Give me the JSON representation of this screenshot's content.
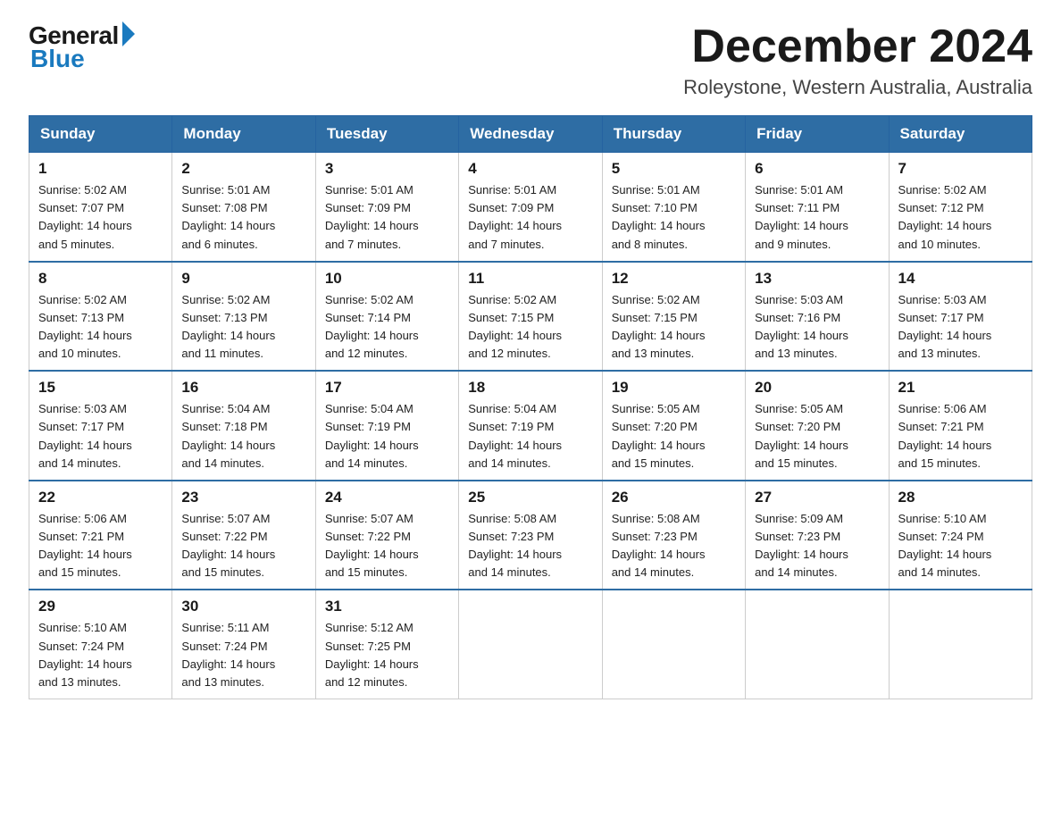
{
  "logo": {
    "general": "General",
    "blue": "Blue"
  },
  "title": "December 2024",
  "location": "Roleystone, Western Australia, Australia",
  "weekdays": [
    "Sunday",
    "Monday",
    "Tuesday",
    "Wednesday",
    "Thursday",
    "Friday",
    "Saturday"
  ],
  "weeks": [
    [
      {
        "day": "1",
        "info": "Sunrise: 5:02 AM\nSunset: 7:07 PM\nDaylight: 14 hours\nand 5 minutes."
      },
      {
        "day": "2",
        "info": "Sunrise: 5:01 AM\nSunset: 7:08 PM\nDaylight: 14 hours\nand 6 minutes."
      },
      {
        "day": "3",
        "info": "Sunrise: 5:01 AM\nSunset: 7:09 PM\nDaylight: 14 hours\nand 7 minutes."
      },
      {
        "day": "4",
        "info": "Sunrise: 5:01 AM\nSunset: 7:09 PM\nDaylight: 14 hours\nand 7 minutes."
      },
      {
        "day": "5",
        "info": "Sunrise: 5:01 AM\nSunset: 7:10 PM\nDaylight: 14 hours\nand 8 minutes."
      },
      {
        "day": "6",
        "info": "Sunrise: 5:01 AM\nSunset: 7:11 PM\nDaylight: 14 hours\nand 9 minutes."
      },
      {
        "day": "7",
        "info": "Sunrise: 5:02 AM\nSunset: 7:12 PM\nDaylight: 14 hours\nand 10 minutes."
      }
    ],
    [
      {
        "day": "8",
        "info": "Sunrise: 5:02 AM\nSunset: 7:13 PM\nDaylight: 14 hours\nand 10 minutes."
      },
      {
        "day": "9",
        "info": "Sunrise: 5:02 AM\nSunset: 7:13 PM\nDaylight: 14 hours\nand 11 minutes."
      },
      {
        "day": "10",
        "info": "Sunrise: 5:02 AM\nSunset: 7:14 PM\nDaylight: 14 hours\nand 12 minutes."
      },
      {
        "day": "11",
        "info": "Sunrise: 5:02 AM\nSunset: 7:15 PM\nDaylight: 14 hours\nand 12 minutes."
      },
      {
        "day": "12",
        "info": "Sunrise: 5:02 AM\nSunset: 7:15 PM\nDaylight: 14 hours\nand 13 minutes."
      },
      {
        "day": "13",
        "info": "Sunrise: 5:03 AM\nSunset: 7:16 PM\nDaylight: 14 hours\nand 13 minutes."
      },
      {
        "day": "14",
        "info": "Sunrise: 5:03 AM\nSunset: 7:17 PM\nDaylight: 14 hours\nand 13 minutes."
      }
    ],
    [
      {
        "day": "15",
        "info": "Sunrise: 5:03 AM\nSunset: 7:17 PM\nDaylight: 14 hours\nand 14 minutes."
      },
      {
        "day": "16",
        "info": "Sunrise: 5:04 AM\nSunset: 7:18 PM\nDaylight: 14 hours\nand 14 minutes."
      },
      {
        "day": "17",
        "info": "Sunrise: 5:04 AM\nSunset: 7:19 PM\nDaylight: 14 hours\nand 14 minutes."
      },
      {
        "day": "18",
        "info": "Sunrise: 5:04 AM\nSunset: 7:19 PM\nDaylight: 14 hours\nand 14 minutes."
      },
      {
        "day": "19",
        "info": "Sunrise: 5:05 AM\nSunset: 7:20 PM\nDaylight: 14 hours\nand 15 minutes."
      },
      {
        "day": "20",
        "info": "Sunrise: 5:05 AM\nSunset: 7:20 PM\nDaylight: 14 hours\nand 15 minutes."
      },
      {
        "day": "21",
        "info": "Sunrise: 5:06 AM\nSunset: 7:21 PM\nDaylight: 14 hours\nand 15 minutes."
      }
    ],
    [
      {
        "day": "22",
        "info": "Sunrise: 5:06 AM\nSunset: 7:21 PM\nDaylight: 14 hours\nand 15 minutes."
      },
      {
        "day": "23",
        "info": "Sunrise: 5:07 AM\nSunset: 7:22 PM\nDaylight: 14 hours\nand 15 minutes."
      },
      {
        "day": "24",
        "info": "Sunrise: 5:07 AM\nSunset: 7:22 PM\nDaylight: 14 hours\nand 15 minutes."
      },
      {
        "day": "25",
        "info": "Sunrise: 5:08 AM\nSunset: 7:23 PM\nDaylight: 14 hours\nand 14 minutes."
      },
      {
        "day": "26",
        "info": "Sunrise: 5:08 AM\nSunset: 7:23 PM\nDaylight: 14 hours\nand 14 minutes."
      },
      {
        "day": "27",
        "info": "Sunrise: 5:09 AM\nSunset: 7:23 PM\nDaylight: 14 hours\nand 14 minutes."
      },
      {
        "day": "28",
        "info": "Sunrise: 5:10 AM\nSunset: 7:24 PM\nDaylight: 14 hours\nand 14 minutes."
      }
    ],
    [
      {
        "day": "29",
        "info": "Sunrise: 5:10 AM\nSunset: 7:24 PM\nDaylight: 14 hours\nand 13 minutes."
      },
      {
        "day": "30",
        "info": "Sunrise: 5:11 AM\nSunset: 7:24 PM\nDaylight: 14 hours\nand 13 minutes."
      },
      {
        "day": "31",
        "info": "Sunrise: 5:12 AM\nSunset: 7:25 PM\nDaylight: 14 hours\nand 12 minutes."
      },
      null,
      null,
      null,
      null
    ]
  ]
}
